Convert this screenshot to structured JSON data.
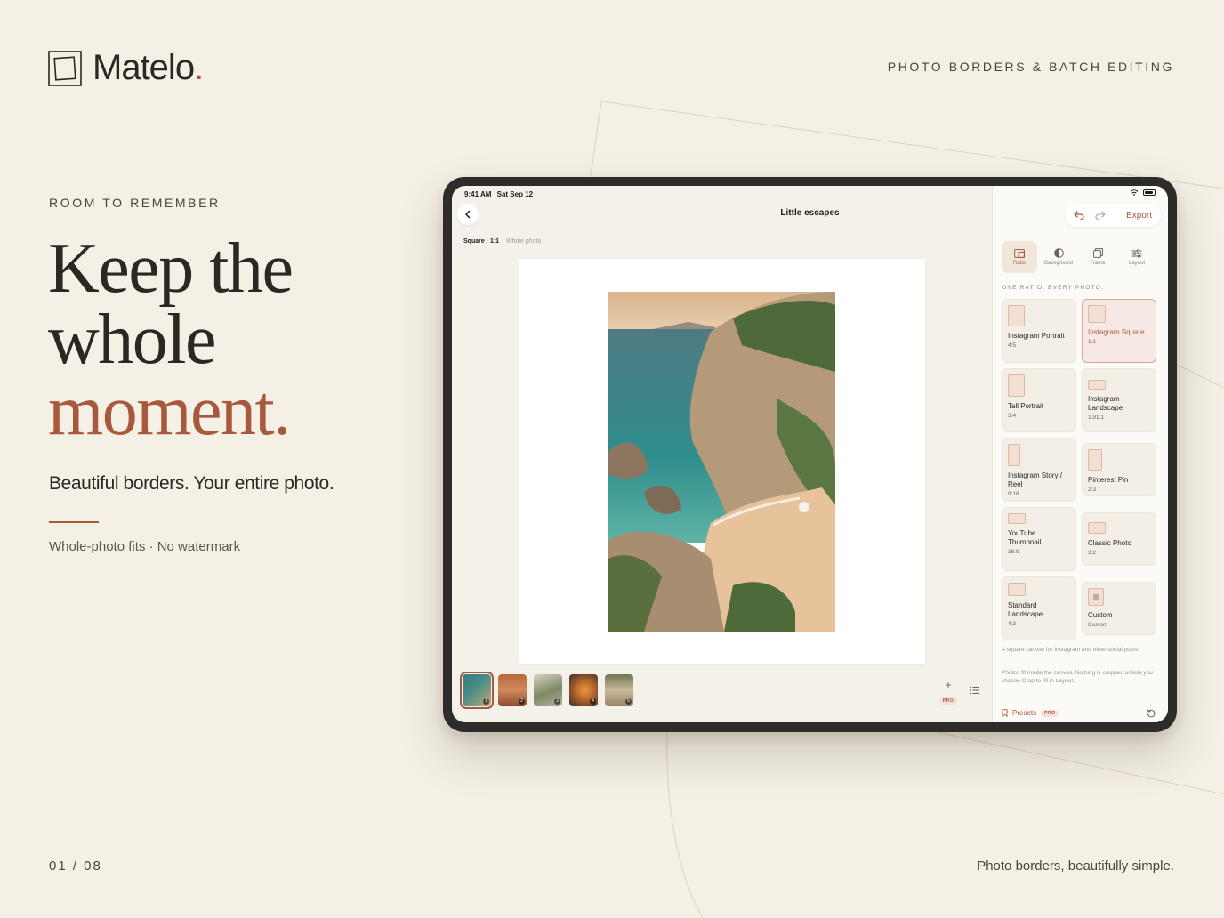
{
  "brand": {
    "name": "Matelo",
    "dot": "."
  },
  "top_tag": "PHOTO BORDERS & BATCH EDITING",
  "eyebrow": "ROOM TO REMEMBER",
  "headline": {
    "line1": "Keep the",
    "line2": "whole",
    "line3": "moment."
  },
  "subhead": "Beautiful borders. Your entire photo.",
  "features": "Whole-photo fits · No watermark",
  "page_num": "01 / 08",
  "footer_tag": "Photo borders, beautifully simple.",
  "device": {
    "time": "9:41 AM",
    "date": "Sat Sep 12",
    "doc_title": "Little escapes",
    "crumb": {
      "ratio": "Square · 1:1",
      "mode": "Whole photo"
    },
    "export_label": "Export",
    "tabs": [
      {
        "label": "Ratio",
        "icon": "ratio-icon",
        "active": true
      },
      {
        "label": "Background",
        "icon": "background-icon",
        "active": false
      },
      {
        "label": "Frame",
        "icon": "frame-icon",
        "active": false
      },
      {
        "label": "Layout",
        "icon": "layout-icon",
        "active": false
      }
    ],
    "section_label": "ONE RATIO. EVERY PHOTO.",
    "ratios": [
      {
        "name": "Instagram Portrait",
        "ratio": "4:5",
        "active": false
      },
      {
        "name": "Instagram Square",
        "ratio": "1:1",
        "active": true
      },
      {
        "name": "Tall Portrait",
        "ratio": "3:4",
        "active": false
      },
      {
        "name": "Instagram Landscape",
        "ratio": "1.91:1",
        "active": false
      },
      {
        "name": "Instagram Story / Reel",
        "ratio": "9:16",
        "active": false
      },
      {
        "name": "Pinterest Pin",
        "ratio": "2:3",
        "active": false
      },
      {
        "name": "YouTube Thumbnail",
        "ratio": "16:9",
        "active": false
      },
      {
        "name": "Classic Photo",
        "ratio": "3:2",
        "active": false
      },
      {
        "name": "Standard Landscape",
        "ratio": "4:3",
        "active": false
      },
      {
        "name": "Custom",
        "ratio": "Custom",
        "active": false
      }
    ],
    "hint1": "A square canvas for Instagram and other social posts.",
    "hint2": "Photos fit inside the canvas. Nothing is cropped unless you choose Crop to fill in Layout.",
    "presets_label": "Presets",
    "pro_label": "PRO",
    "thumbnails": [
      {
        "n": "1",
        "active": true
      },
      {
        "n": "2",
        "active": false
      },
      {
        "n": "3",
        "active": false
      },
      {
        "n": "4",
        "active": false
      },
      {
        "n": "5",
        "active": false
      }
    ]
  },
  "colors": {
    "accent": "#a8583c",
    "background": "#f5f0e5",
    "ink": "#2b2722"
  }
}
